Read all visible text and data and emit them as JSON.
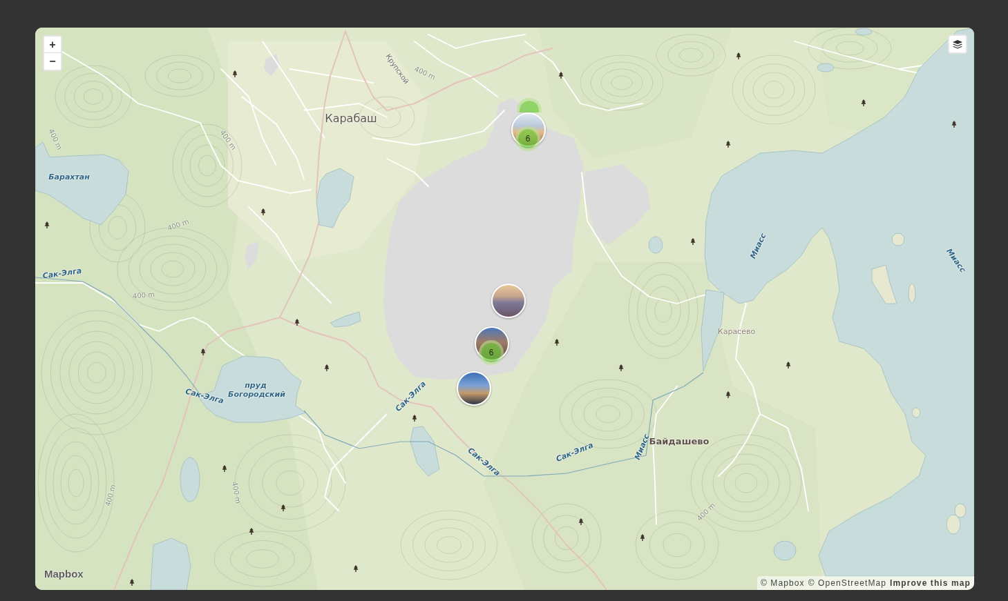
{
  "map": {
    "zoom_controls": [
      {
        "label": "+"
      },
      {
        "label": "−"
      }
    ],
    "labels": [
      {
        "text": "Крупской",
        "kind": "street"
      },
      {
        "text": "400 m",
        "kind": "contour"
      },
      {
        "text": "Карабаш",
        "kind": "town"
      },
      {
        "text": "400 m",
        "kind": "contour"
      },
      {
        "text": "400 m",
        "kind": "contour"
      },
      {
        "text": "Барахтан",
        "kind": "water"
      },
      {
        "text": "400 m",
        "kind": "contour"
      },
      {
        "text": "Миасс",
        "kind": "water"
      },
      {
        "text": "Миасс",
        "kind": "water"
      },
      {
        "text": "Сак-Элга",
        "kind": "water"
      },
      {
        "text": "400 m",
        "kind": "contour"
      },
      {
        "text": "Карасево",
        "kind": "hamlet"
      },
      {
        "text": "пруд Богородский",
        "kind": "water"
      },
      {
        "text": "Сак-Элга",
        "kind": "water"
      },
      {
        "text": "Сак-Элга",
        "kind": "water"
      },
      {
        "text": "Байдашево",
        "kind": "village"
      },
      {
        "text": "Миасс",
        "kind": "water"
      },
      {
        "text": "Сак-Элга",
        "kind": "water"
      },
      {
        "text": "Сак-Элга",
        "kind": "water"
      },
      {
        "text": "400 m",
        "kind": "contour"
      },
      {
        "text": "400 m",
        "kind": "contour"
      },
      {
        "text": "400 m",
        "kind": "contour"
      }
    ],
    "markers": [
      {
        "kind": "cluster"
      },
      {
        "kind": "photo_cluster",
        "count": "6"
      },
      {
        "kind": "photo"
      },
      {
        "kind": "photo_cluster",
        "count": "6"
      },
      {
        "kind": "photo"
      }
    ],
    "logo": "Mapbox",
    "attribution": [
      {
        "text": "© Mapbox",
        "bold": false
      },
      {
        "text": "© OpenStreetMap",
        "bold": false
      },
      {
        "text": "Improve this map",
        "bold": true
      }
    ]
  }
}
